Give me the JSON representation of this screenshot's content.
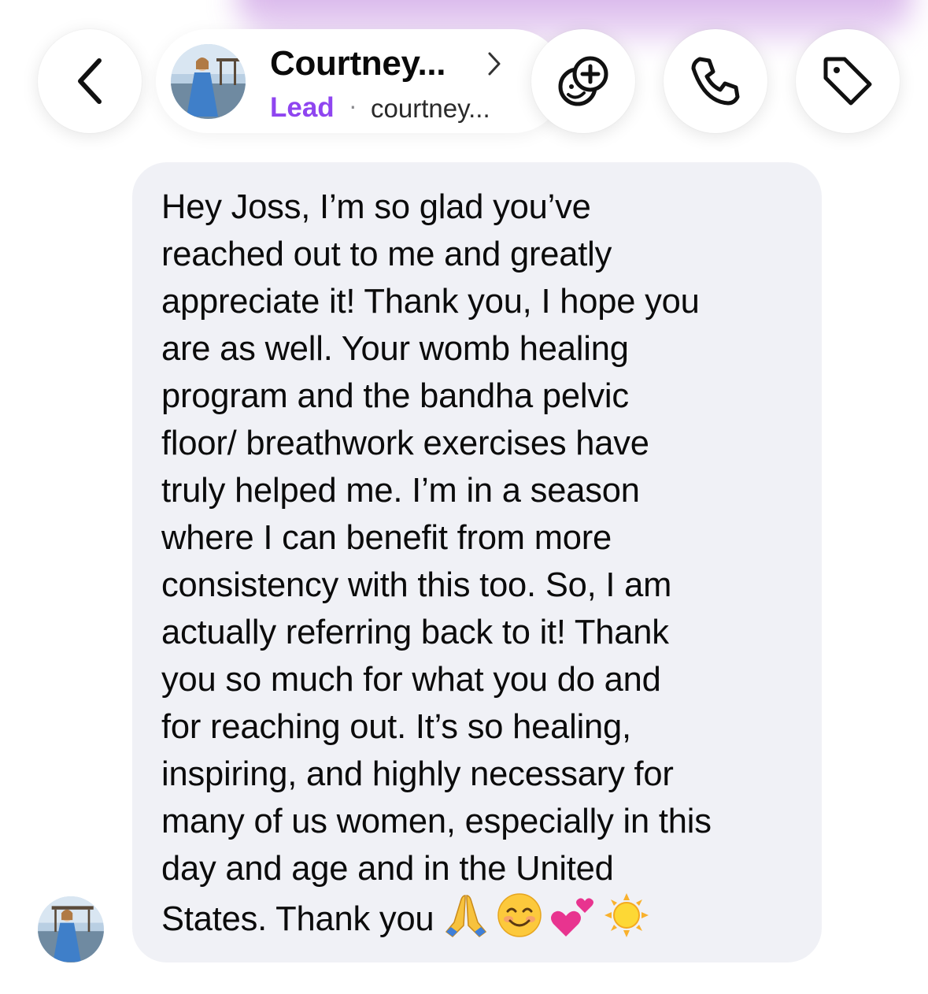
{
  "header": {
    "contact_name": "Courtney...",
    "status_label": "Lead",
    "separator": "·",
    "username": "courtney..."
  },
  "icons": {
    "back": "chevron-left-icon",
    "name_chevron": "chevron-right-icon",
    "sticker": "add-sticker-icon",
    "call": "phone-icon",
    "tag": "tag-icon"
  },
  "colors": {
    "lead_accent": "#8f45f0",
    "bubble_bg": "#f0f1f6",
    "glow": "#d7b2ea"
  },
  "message": {
    "lines": [
      "Hey Joss, I’m so glad you’ve",
      "reached out to me and greatly",
      "appreciate it! Thank you, I hope you",
      "are as well. Your womb healing",
      "program and the bandha pelvic",
      "floor/ breathwork exercises have",
      "truly helped me. I’m in a season",
      "where I can benefit from more",
      "consistency with this too. So, I am",
      "actually referring back to it! Thank",
      "you so much for what you do and",
      "for reaching out. It’s so healing,",
      "inspiring, and highly necessary for",
      "many of us women, especially in this",
      "day and age and in the United"
    ],
    "last_line_text": "States. Thank you",
    "emojis": [
      "folded-hands",
      "smiling-face",
      "two-hearts",
      "sun"
    ]
  }
}
